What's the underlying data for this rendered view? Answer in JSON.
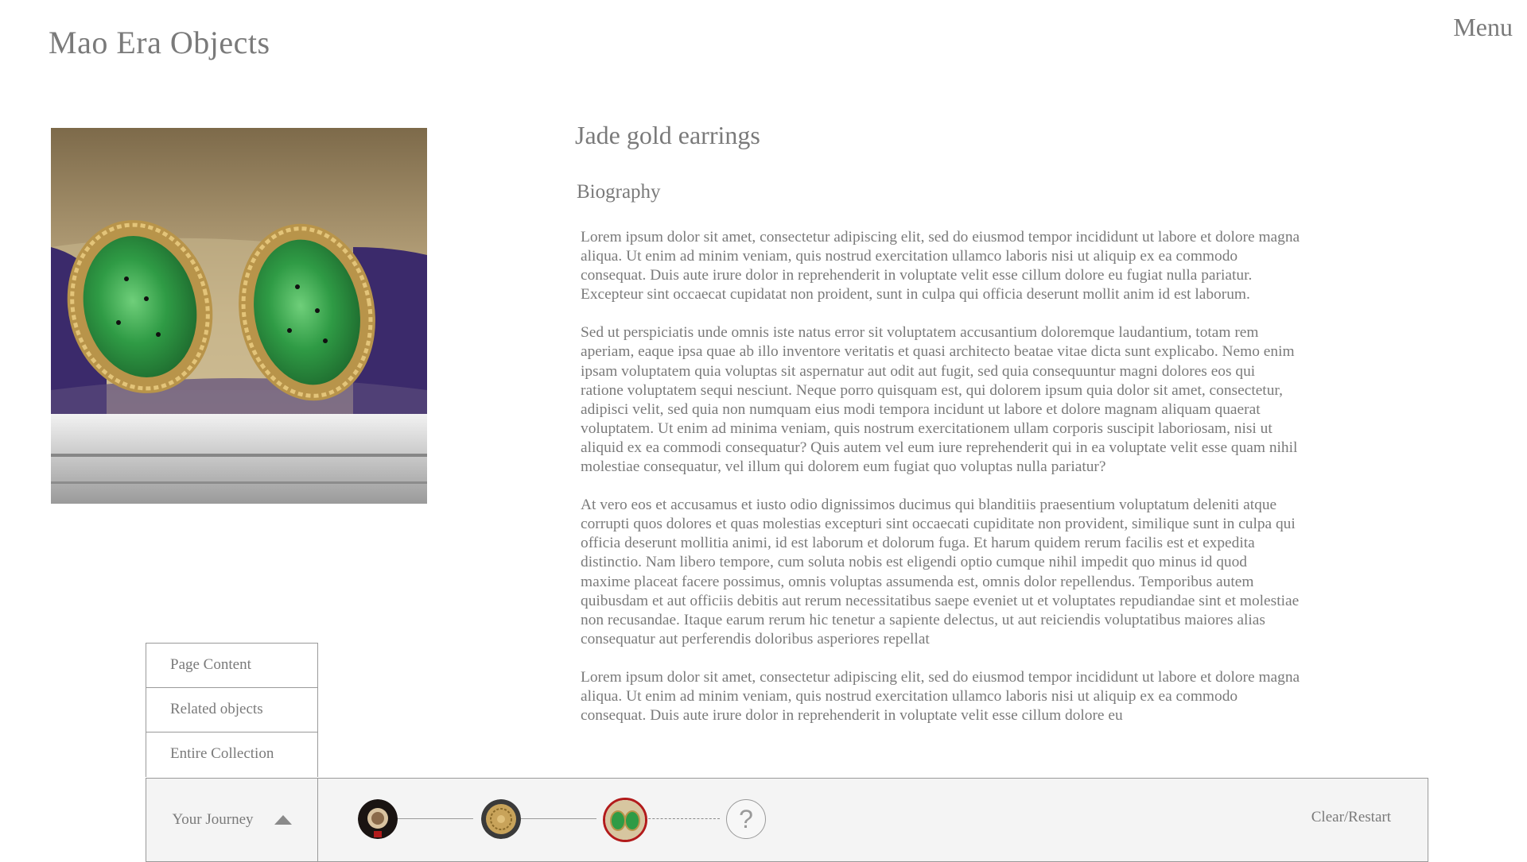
{
  "header": {
    "site_title": "Mao Era Objects",
    "menu_label": "Menu"
  },
  "object": {
    "title": "Jade gold earrings",
    "image_name": "jade-gold-earrings-photo",
    "section_heading": "Biography",
    "paragraphs": [
      "Lorem ipsum dolor sit amet, consectetur adipiscing elit, sed do eiusmod tempor incididunt ut labore et dolore magna aliqua. Ut enim ad minim veniam, quis nostrud exercitation ullamco laboris nisi ut aliquip ex ea commodo consequat. Duis aute irure dolor in reprehenderit in voluptate velit esse cillum dolore eu fugiat nulla pariatur. Excepteur sint occaecat cupidatat non proident, sunt in culpa qui officia deserunt mollit anim id est laborum.",
      "Sed ut perspiciatis unde omnis iste natus error sit voluptatem accusantium doloremque laudantium, totam rem aperiam, eaque ipsa quae ab illo inventore veritatis et quasi architecto beatae vitae dicta sunt explicabo. Nemo enim ipsam voluptatem quia voluptas sit aspernatur aut odit aut fugit, sed quia consequuntur magni dolores eos qui ratione voluptatem sequi nesciunt. Neque porro quisquam est, qui dolorem ipsum quia dolor sit amet, consectetur, adipisci velit, sed quia non numquam eius modi tempora incidunt ut labore et dolore magnam aliquam quaerat voluptatem. Ut enim ad minima veniam, quis nostrum exercitationem ullam corporis suscipit laboriosam, nisi ut aliquid ex ea commodi consequatur? Quis autem vel eum iure reprehenderit qui in ea voluptate velit esse quam nihil molestiae consequatur, vel illum qui dolorem eum fugiat quo voluptas nulla pariatur?",
      "At vero eos et accusamus et iusto odio dignissimos ducimus qui blanditiis praesentium voluptatum deleniti atque corrupti quos dolores et quas molestias excepturi sint occaecati cupiditate non provident, similique sunt in culpa qui officia deserunt mollitia animi, id est laborum et dolorum fuga. Et harum quidem rerum facilis est et expedita distinctio. Nam libero tempore, cum soluta nobis est eligendi optio cumque nihil impedit quo minus id quod maxime placeat facere possimus, omnis voluptas assumenda est, omnis dolor repellendus. Temporibus autem quibusdam et aut officiis debitis aut rerum necessitatibus saepe eveniet ut et voluptates repudiandae sint et molestiae non recusandae. Itaque earum rerum hic tenetur a sapiente delectus, ut aut reiciendis voluptatibus maiores alias consequatur aut perferendis doloribus asperiores repellat",
      "Lorem ipsum dolor sit amet, consectetur adipiscing elit, sed do eiusmod tempor incididunt ut labore et dolore magna aliqua. Ut enim ad minim veniam, quis nostrud exercitation ullamco laboris nisi ut aliquip ex ea commodo consequat. Duis aute irure dolor in reprehenderit in voluptate velit esse cillum dolore eu"
    ]
  },
  "side_nav": {
    "items": [
      {
        "label": "Page Content"
      },
      {
        "label": "Related objects"
      },
      {
        "label": "Entire Collection"
      }
    ]
  },
  "journey": {
    "label": "Your Journey",
    "toggle_icon": "caret-up-icon",
    "nodes": [
      {
        "name": "journey-node-1",
        "icon": "object-thumbnail-1",
        "current": false
      },
      {
        "name": "journey-node-2",
        "icon": "object-thumbnail-2",
        "current": false
      },
      {
        "name": "journey-node-3",
        "icon": "object-thumbnail-3",
        "current": true
      }
    ],
    "next_placeholder": "?",
    "clear_label": "Clear/Restart",
    "current_ring_color": "#b21b1b"
  }
}
